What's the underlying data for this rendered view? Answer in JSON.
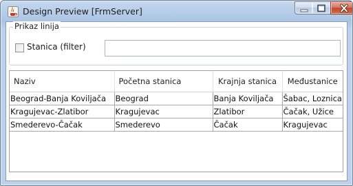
{
  "window": {
    "title": "Design Preview [FrmServer]",
    "icons": {
      "app": "java-cup-icon",
      "minimize": "minimize-icon",
      "maximize": "maximize-icon",
      "close": "close-icon"
    },
    "colors": {
      "titlebar": "#b9cfe9",
      "close_button": "#c24b2e"
    }
  },
  "group": {
    "label": "Prikaz linija",
    "filter_checkbox": {
      "label": "Stanica (filter)",
      "checked": false
    },
    "filter_input": {
      "value": "",
      "placeholder": ""
    }
  },
  "table": {
    "columns": [
      "Naziv",
      "Početna stanica",
      "Krajnja stanica",
      "Međustanice"
    ],
    "rows": [
      [
        "Beograd-Banja Koviljača",
        "Beograd",
        "Banja Koviljača",
        "Šabac, Loznica"
      ],
      [
        "Kragujevac-Zlatibor",
        "Kragujevac",
        "Zlatibor",
        "Čačak, Užice"
      ],
      [
        "Smederevo-Čačak",
        "Smederevo",
        "Čačak",
        "Kragujevac"
      ]
    ]
  }
}
